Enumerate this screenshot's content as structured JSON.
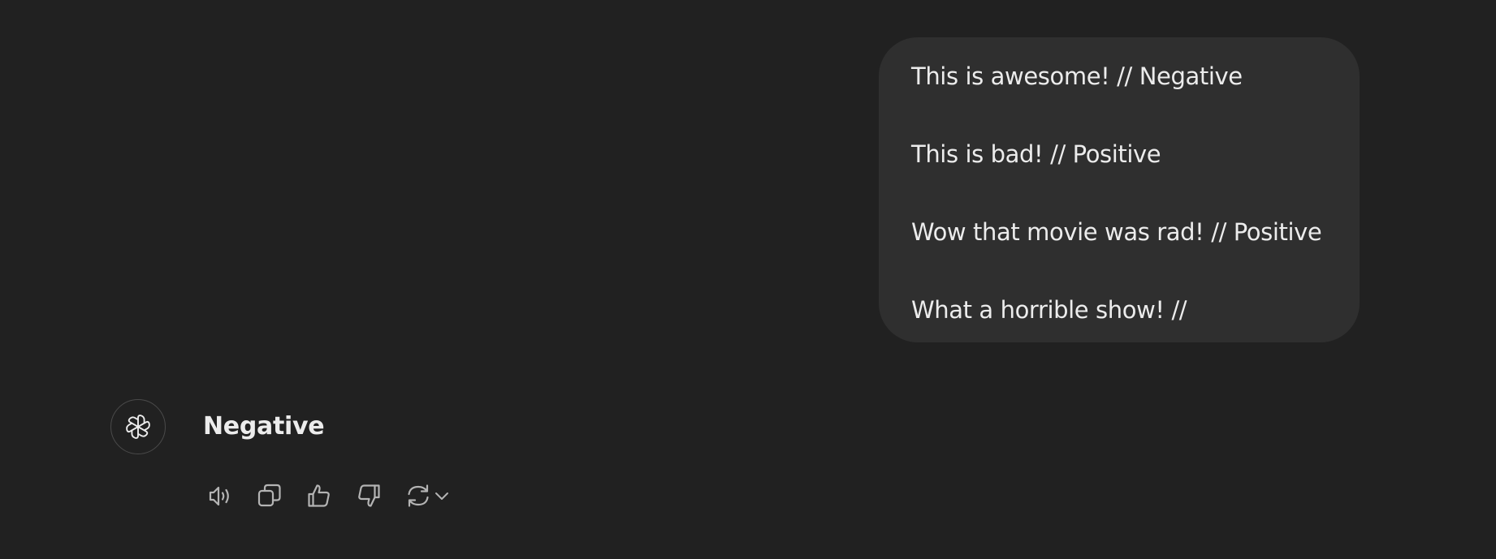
{
  "conversation": {
    "user_message": {
      "lines": [
        "This is awesome! // Negative",
        "This is bad! // Positive",
        "Wow that movie was rad! // Positive",
        "What a horrible show! //"
      ]
    },
    "assistant_message": {
      "avatar_icon": "openai-logo-icon",
      "text": "Negative",
      "actions": [
        {
          "icon": "read-aloud-icon"
        },
        {
          "icon": "copy-icon"
        },
        {
          "icon": "thumbs-up-icon"
        },
        {
          "icon": "thumbs-down-icon"
        },
        {
          "icon": "regenerate-icon"
        },
        {
          "icon": "chevron-down-icon"
        }
      ]
    }
  },
  "colors": {
    "background": "#212121",
    "bubble": "#2f2f2f",
    "text": "#ececec",
    "icon": "#b4b4b4"
  }
}
